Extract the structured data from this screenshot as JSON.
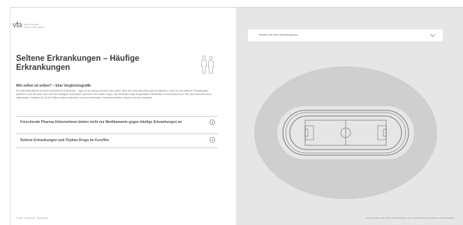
{
  "logo": {
    "mark": "vfa",
    "text": "Die forschenden Pharma-Unternehmen"
  },
  "header": {
    "title": "Seltene Erkrankungen – Häufige Erkrankungen"
  },
  "intro": {
    "subtitle": "Wie selten ist selten? – Eine Vergleichsgrafik",
    "body": "Für jeden Betroffenen ist seine Krankheit die Schlimmste – egal, ob sie häufig vorkommt oder selten. Aber wie wenig Betroffene gibt es eigentlich, wenn wir von seltenen Erkrankungen sprechen? Und wie viele, wenn wir über häufigere Krankheiten sprechen? Wir wollen zeigen, wie verbreitet einige ausgewählte Krankheiten in Deutschland sind. Wie viele Besucher eines vollbesetzten Stadions mit 75.000 Plätzen wären statistisch von einer bestimmten Krankheit betroffen? Machen Sie den Vergleich!"
  },
  "accordion": [
    {
      "label": "Forschende Pharma-Unternehmen bieten nicht nur Medikamente gegen häufige Erkrankungen an"
    },
    {
      "label": "Seltene Erkrankungen und Orphan Drugs im Kurzfilm"
    }
  ],
  "footer": {
    "left": "© 2017 · Impressum · Datenschutz",
    "right": "Dieses Stadion hat 75.000 Besucherplätze, etwa vergleichbar mit dem Berliner Olympiastadion"
  },
  "dropdown": {
    "placeholder": "Wählen Sie eine Erkrankung aus"
  },
  "colors": {
    "panel": "#e6e6e6",
    "stands": "#cfcfcf",
    "accent": "#444444"
  }
}
